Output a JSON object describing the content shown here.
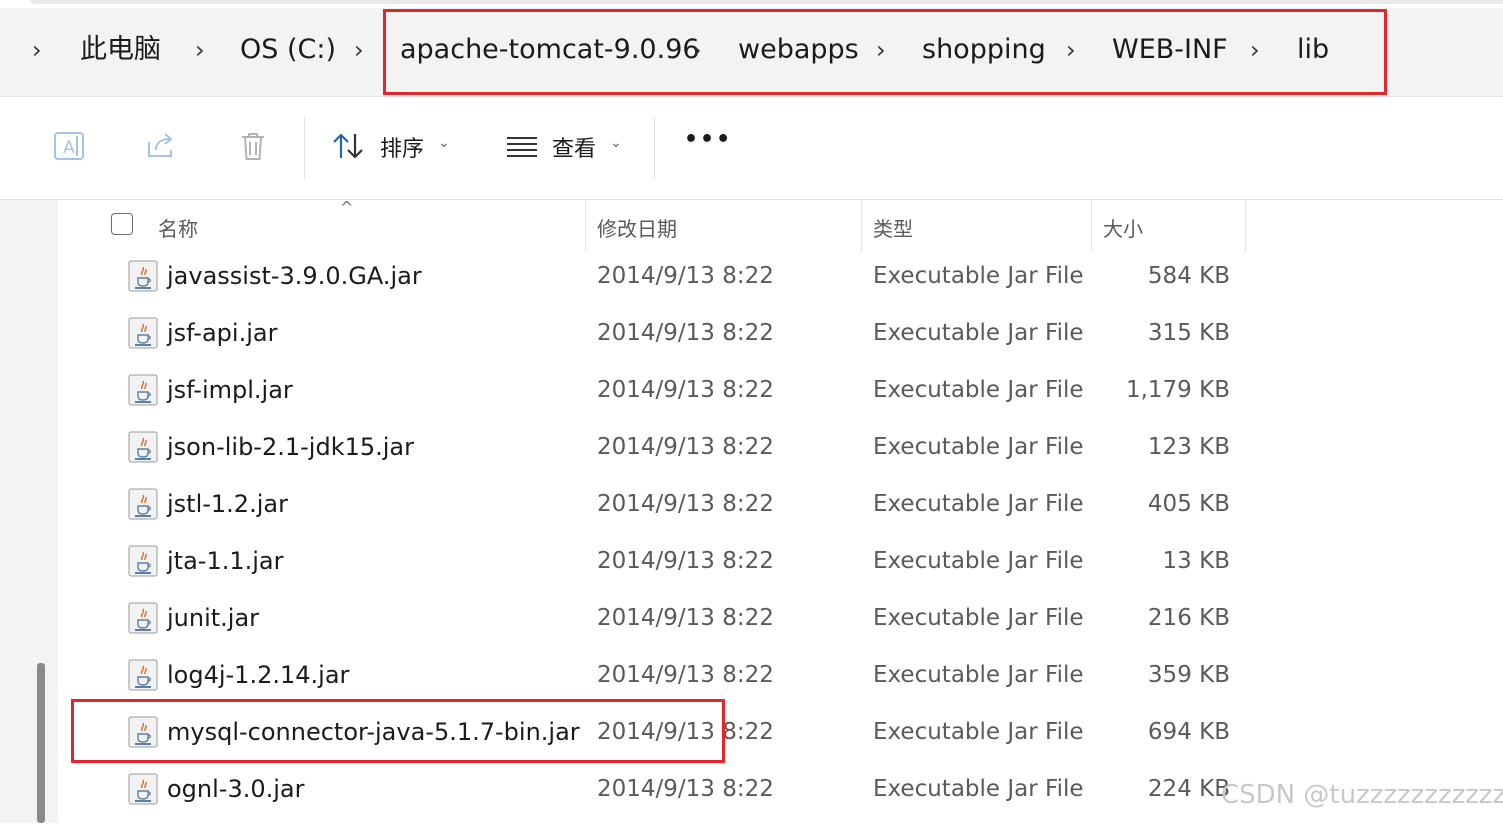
{
  "address_bar": {
    "crumbs": [
      "此电脑",
      "OS (C:)",
      "apache-tomcat-9.0.96",
      "webapps",
      "shopping",
      "WEB-INF",
      "lib"
    ],
    "separator": "›"
  },
  "toolbar": {
    "sort_label": "排序",
    "view_label": "查看",
    "more_label": "•••"
  },
  "list": {
    "columns": {
      "name": "名称",
      "modified": "修改日期",
      "type": "类型",
      "size": "大小"
    },
    "rows": [
      {
        "name": "javassist-3.9.0.GA.jar",
        "modified": "2014/9/13 8:22",
        "type": "Executable Jar File",
        "size": "584 KB"
      },
      {
        "name": "jsf-api.jar",
        "modified": "2014/9/13 8:22",
        "type": "Executable Jar File",
        "size": "315 KB"
      },
      {
        "name": "jsf-impl.jar",
        "modified": "2014/9/13 8:22",
        "type": "Executable Jar File",
        "size": "1,179 KB"
      },
      {
        "name": "json-lib-2.1-jdk15.jar",
        "modified": "2014/9/13 8:22",
        "type": "Executable Jar File",
        "size": "123 KB"
      },
      {
        "name": "jstl-1.2.jar",
        "modified": "2014/9/13 8:22",
        "type": "Executable Jar File",
        "size": "405 KB"
      },
      {
        "name": "jta-1.1.jar",
        "modified": "2014/9/13 8:22",
        "type": "Executable Jar File",
        "size": "13 KB"
      },
      {
        "name": "junit.jar",
        "modified": "2014/9/13 8:22",
        "type": "Executable Jar File",
        "size": "216 KB"
      },
      {
        "name": "log4j-1.2.14.jar",
        "modified": "2014/9/13 8:22",
        "type": "Executable Jar File",
        "size": "359 KB"
      },
      {
        "name": "mysql-connector-java-5.1.7-bin.jar",
        "modified": "2014/9/13 8:22",
        "type": "Executable Jar File",
        "size": "694 KB"
      },
      {
        "name": "ognl-3.0.jar",
        "modified": "2014/9/13 8:22",
        "type": "Executable Jar File",
        "size": "224 KB"
      }
    ]
  },
  "watermark": "CSDN @tuzzzzzzzzzzz",
  "colors": {
    "highlight": "#e5252a",
    "address_bg": "#f3f3f3"
  }
}
